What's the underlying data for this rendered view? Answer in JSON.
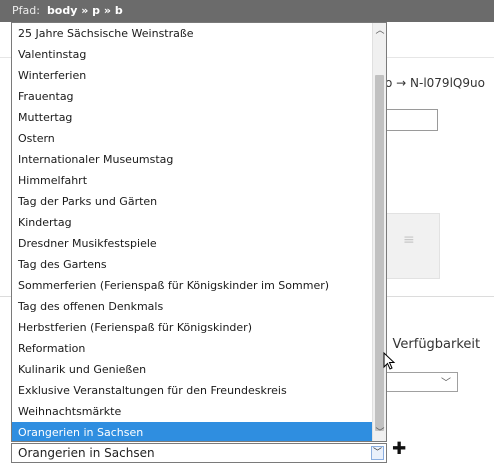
{
  "path": {
    "label": "Pfad:",
    "value": "body » p » b"
  },
  "background": {
    "slug_text": "o → N-l079lQ9uo",
    "availability_label": ": Verfügbarkeit"
  },
  "dropdown": {
    "options": [
      "25 Jahre Sächsische Weinstraße",
      "Valentinstag",
      "Winterferien",
      "Frauentag",
      "Muttertag",
      "Ostern",
      "Internationaler Museumstag",
      "Himmelfahrt",
      "Tag der Parks und Gärten",
      "Kindertag",
      "Dresdner Musikfestspiele",
      "Tag des Gartens",
      "Sommerferien (Ferienspaß für Königskinder im Sommer)",
      "Tag des offenen Denkmals",
      "Herbstferien (Ferienspaß für Königskinder)",
      "Reformation",
      "Kulinarik und Genießen",
      "Exklusive Veranstaltungen für den Freundeskreis",
      "Weihnachtsmärkte",
      "Orangerien in Sachsen"
    ],
    "selected_index": 19,
    "selected_value": "Orangerien in Sachsen",
    "scroll_up_icon": "chevron-up-icon",
    "scroll_down_icon": "chevron-down-icon"
  },
  "add_icon": "plus-icon",
  "colors": {
    "selection": "#2f8ee0",
    "pathbar": "#6b6b6b"
  }
}
